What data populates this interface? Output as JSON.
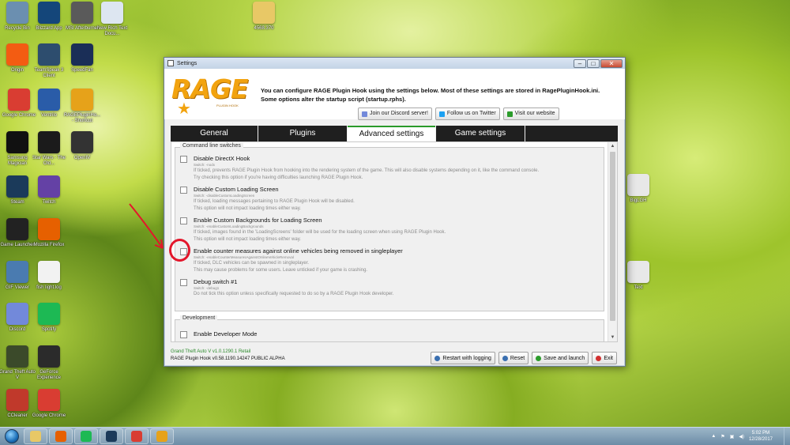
{
  "desktop": {
    "icons": [
      {
        "label": "Recycle Bin",
        "icon": "recycle-bin-icon",
        "color": "#6b8fb0"
      },
      {
        "label": "Blizzard App",
        "icon": "blizzard-icon",
        "color": "#14467a"
      },
      {
        "label": "MSI Afterburner",
        "icon": "msi-icon",
        "color": "#5a5a5a"
      },
      {
        "label": "New Rich Text Docu...",
        "icon": "document-icon",
        "color": "#dde6f1"
      },
      {
        "label": "Origin",
        "icon": "origin-icon",
        "color": "#f35c12"
      },
      {
        "label": "TeamSpeak 3 Client",
        "icon": "teamspeak-icon",
        "color": "#2d4d6e"
      },
      {
        "label": "SpeedFan",
        "icon": "speedfan-icon",
        "color": "#1a2e57"
      },
      {
        "label": "Google Chrome",
        "icon": "chrome-icon",
        "color": "#d93d32"
      },
      {
        "label": "Ventrilo",
        "icon": "ventrilo-icon",
        "color": "#2a5ca8"
      },
      {
        "label": "RAGEPluginHo... - Shortcut",
        "icon": "rage-shortcut-icon",
        "color": "#e6a21a"
      },
      {
        "label": "Samsung Magician",
        "icon": "ssd-icon",
        "color": "#111111"
      },
      {
        "label": "Star Wars - The Old...",
        "icon": "starwars-icon",
        "color": "#1b1b1b"
      },
      {
        "label": "OpenIV",
        "icon": "openiv-icon",
        "color": "#333333"
      },
      {
        "label": "Steam",
        "icon": "steam-icon",
        "color": "#1b3a5a"
      },
      {
        "label": "Twitch",
        "icon": "twitch-icon",
        "color": "#6441a5"
      },
      {
        "label": "Game Launcher",
        "icon": "game-launcher-icon",
        "color": "#222222"
      },
      {
        "label": "Mozilla Firefox",
        "icon": "firefox-icon",
        "color": "#e66000"
      },
      {
        "label": "GIF Viewer",
        "icon": "gif-viewer-icon",
        "color": "#4a7bb0"
      },
      {
        "label": "fish light.log",
        "icon": "log-file-icon",
        "color": "#f2f2f2"
      },
      {
        "label": "Discord",
        "icon": "discord-icon",
        "color": "#7289da"
      },
      {
        "label": "Spotify",
        "icon": "spotify-icon",
        "color": "#1db954"
      },
      {
        "label": "Grand Theft Auto V",
        "icon": "gta-icon",
        "color": "#3b4a2a"
      },
      {
        "label": "GeForce Experience",
        "icon": "geforce-icon",
        "color": "#2b2b2b"
      },
      {
        "label": "CCleaner",
        "icon": "ccleaner-icon",
        "color": "#c0392b"
      },
      {
        "label": "Google Chrome",
        "icon": "chrome-icon",
        "color": "#d93d32"
      },
      {
        "label": "4568.370",
        "icon": "folder-icon",
        "color": "#e8c866"
      },
      {
        "label": "BigLGH",
        "icon": "file-icon",
        "color": "#e8e8e8"
      },
      {
        "label": "Text",
        "icon": "text-file-icon",
        "color": "#e8e8e8"
      }
    ]
  },
  "window": {
    "title": "Settings",
    "controls": {
      "minimize": "–",
      "maximize": "□",
      "close": "✕"
    }
  },
  "header": {
    "logo_text": "RAGE",
    "logo_sub": "PLUGIN HOOK",
    "intro": "You can configure RAGE Plugin Hook using the settings below. Most of these settings are stored in RagePluginHook.ini. Some options alter the startup script (startup.rphs).",
    "social": [
      {
        "label": "Join our Discord server!",
        "icon": "discord-icon",
        "color": "#7289da"
      },
      {
        "label": "Follow us on Twitter",
        "icon": "twitter-icon",
        "color": "#1da1f2"
      },
      {
        "label": "Visit our website",
        "icon": "globe-icon",
        "color": "#2c9c2c"
      }
    ]
  },
  "tabs": [
    {
      "label": "General",
      "active": false
    },
    {
      "label": "Plugins",
      "active": false
    },
    {
      "label": "Advanced settings",
      "active": true
    },
    {
      "label": "Game settings",
      "active": false
    }
  ],
  "command_line": {
    "legend": "Command line switches",
    "options": [
      {
        "title": "Disable DirectX Hook",
        "switch": "Switch: -nodx",
        "desc1": "If ticked, prevents RAGE Plugin Hook from hooking into the rendering system of the game. This will also disable systems depending on it, like the command console.",
        "desc2": "Try checking this option if you're having difficulties launching RAGE Plugin Hook.",
        "checked": false
      },
      {
        "title": "Disable Custom Loading Screen",
        "switch": "Switch: -disableCustomLoadingScreen",
        "desc1": "If ticked, loading messages pertaining to RAGE Plugin Hook will be disabled.",
        "desc2": "This option will not impact loading times either way.",
        "checked": false
      },
      {
        "title": "Enable Custom Backgrounds for Loading Screen",
        "switch": "Switch: -enableCustomLoadingBackgrounds",
        "desc1": "If ticked, images found in the 'LoadingScreens' folder will be used for the loading screen when using RAGE Plugin Hook.",
        "desc2": "This option will not impact loading times either way.",
        "checked": false
      },
      {
        "title": "Enable counter measures against online vehicles being removed in singleplayer",
        "switch": "Switch: -enableCounterMeasuresAgainstOnlineVehicleRemoval",
        "desc1": "If ticked, DLC vehicles can be spawned in singleplayer.",
        "desc2": "This may cause problems for some users. Leave unticked if your game is crashing.",
        "checked": false
      },
      {
        "title": "Debug switch #1",
        "switch": "Switch: -debug1",
        "desc1": "Do not tick this option unless specifically requested to do so by a RAGE Plugin Hook developer.",
        "desc2": "",
        "checked": false
      }
    ]
  },
  "development": {
    "legend": "Development",
    "options": [
      {
        "title": "Enable Developer Mode",
        "checked": false
      }
    ]
  },
  "footer": {
    "game_version": "Grand Theft Auto V v1.0.1290.1 Retail",
    "hook_version": "RAGE Plugin Hook v0.58.1190.14247 PUBLIC ALPHA"
  },
  "actions": [
    {
      "label": "Restart with logging",
      "icon": "restart-log-icon",
      "color": "#3a6fb0"
    },
    {
      "label": "Reset",
      "icon": "reset-icon",
      "color": "#3a6fb0"
    },
    {
      "label": "Save and launch",
      "icon": "save-launch-icon",
      "color": "#2c9c2c"
    },
    {
      "label": "Exit",
      "icon": "exit-icon",
      "color": "#d23030"
    }
  ],
  "taskbar": {
    "apps": [
      {
        "name": "explorer-icon",
        "color": "#e8c866"
      },
      {
        "name": "firefox-icon",
        "color": "#e66000"
      },
      {
        "name": "spotify-icon",
        "color": "#1db954"
      },
      {
        "name": "steam-icon",
        "color": "#1b3a5a"
      },
      {
        "name": "chrome-icon",
        "color": "#d93d32"
      },
      {
        "name": "rage-icon",
        "color": "#e6a21a"
      }
    ],
    "time": "5:02 PM",
    "date": "12/28/2017"
  }
}
